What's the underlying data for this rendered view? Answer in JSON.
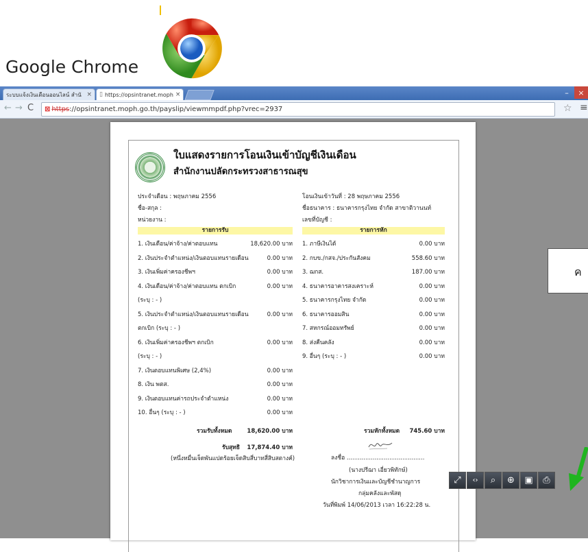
{
  "caption": "Google Chrome",
  "browser": {
    "tabs": [
      {
        "label": "ระบบแจ้งเงินเดือนออนไลน์ สำนั",
        "close": "×"
      },
      {
        "label": "https://opsintranet.moph",
        "close": "×"
      }
    ],
    "window_controls": {
      "minimize": "–",
      "close": "×"
    },
    "url_protocol": "https",
    "url_rest": "://opsintranet.moph.go.th/payslip/viewmmpdf.php?vrec=2937"
  },
  "payslip": {
    "title": "ใบแสดงรายการโอนเงินเข้าบัญชีเงินเดือน",
    "subtitle": "สำนักงานปลัดกระทรวงสาธารณสุข",
    "month": "ประจำเดือน : พฤษภาคม 2556",
    "name": "ชื่อ-สกุล :",
    "unit": "หน่วยงาน :",
    "transfer_date": "โอนเงินเข้าวันที่ : 28 พฤษภาคม 2556",
    "bank": "ชื่อธนาคาร : ธนาคารกรุงไทย จำกัด สาขาติวานนท์",
    "account": "เลขที่บัญชี :",
    "income_header": "รายการรับ",
    "deduct_header": "รายการหัก",
    "income": [
      {
        "label": "1. เงินเดือน/ค่าจ้าง/ค่าตอบแทน",
        "amount": "18,620.00 บาท"
      },
      {
        "label": "2. เงินประจำตำแหน่ง/เงินตอบแทนรายเดือน",
        "amount": "0.00 บาท"
      },
      {
        "label": "3. เงินเพิ่มค่าครองชีพฯ",
        "amount": "0.00 บาท"
      },
      {
        "label": "4. เงินเดือน/ค่าจ้าง/ค่าตอบแทน ตกเบิก",
        "amount": "0.00 บาท"
      },
      {
        "label": "(ระบุ : - )",
        "amount": ""
      },
      {
        "label": "5. เงินประจำตำแหน่ง/เงินตอบแทนรายเดือน",
        "amount": "0.00 บาท"
      },
      {
        "label": "ตกเบิก (ระบุ : - )",
        "amount": ""
      },
      {
        "label": "6. เงินเพิ่มค่าครองชีพฯ ตกเบิก",
        "amount": "0.00 บาท"
      },
      {
        "label": "(ระบุ : - )",
        "amount": ""
      },
      {
        "label": "7. เงินตอบแทนพิเศษ (2,4%)",
        "amount": "0.00 บาท"
      },
      {
        "label": "8. เงิน พตส.",
        "amount": "0.00 บาท"
      },
      {
        "label": "9. เงินตอบแทนค่ารถประจำตำแหน่ง",
        "amount": "0.00 บาท"
      },
      {
        "label": "10. อื่นๆ (ระบุ : - )",
        "amount": "0.00 บาท"
      }
    ],
    "deductions": [
      {
        "label": "1. ภาษีเงินได้",
        "amount": "0.00 บาท"
      },
      {
        "label": "2. กบข./กสจ./ประกันสังคม",
        "amount": "558.60 บาท"
      },
      {
        "label": "3. ฌกส.",
        "amount": "187.00 บาท"
      },
      {
        "label": "4. ธนาคารอาคารสงเคราะห์",
        "amount": "0.00 บาท"
      },
      {
        "label": "5. ธนาคารกรุงไทย จำกัด",
        "amount": "0.00 บาท"
      },
      {
        "label": "6. ธนาคารออมสิน",
        "amount": "0.00 บาท"
      },
      {
        "label": "7. สหกรณ์ออมทรัพย์",
        "amount": "0.00 บาท"
      },
      {
        "label": "8. ส่งคืนคลัง",
        "amount": "0.00 บาท"
      },
      {
        "label": "9. อื่นๆ (ระบุ : - )",
        "amount": "0.00 บาท"
      }
    ],
    "total_income_label": "รวมรับทั้งหมด",
    "total_income": "18,620.00 บาท",
    "total_deduct_label": "รวมหักทั้งหมด",
    "total_deduct": "745.60 บาท",
    "net_label": "รับสุทธิ",
    "net": "17,874.40 บาท",
    "net_words": "(หนึ่งหมื่นเจ็ดพันแปดร้อยเจ็ดสิบสี่บาทสี่สิบสตางค์)",
    "sign_label": "ลงชื่อ ..........................................",
    "signer": "(นางปรีฌา เอี่ยวพิทักษ์)",
    "signer_title": "นักวิชาการเงินและบัญชีชำนาญการ",
    "signer_group": "กลุ่มคลังและพัสดุ",
    "print_date": "วันที่พิมพ์ 14/06/2013 เวลา 16:22:28 น."
  },
  "side_box_text": "ค",
  "viewer_tools": [
    "fit-page-icon",
    "fit-width-icon",
    "zoom-out-icon",
    "zoom-in-icon",
    "save-icon",
    "print-icon"
  ]
}
